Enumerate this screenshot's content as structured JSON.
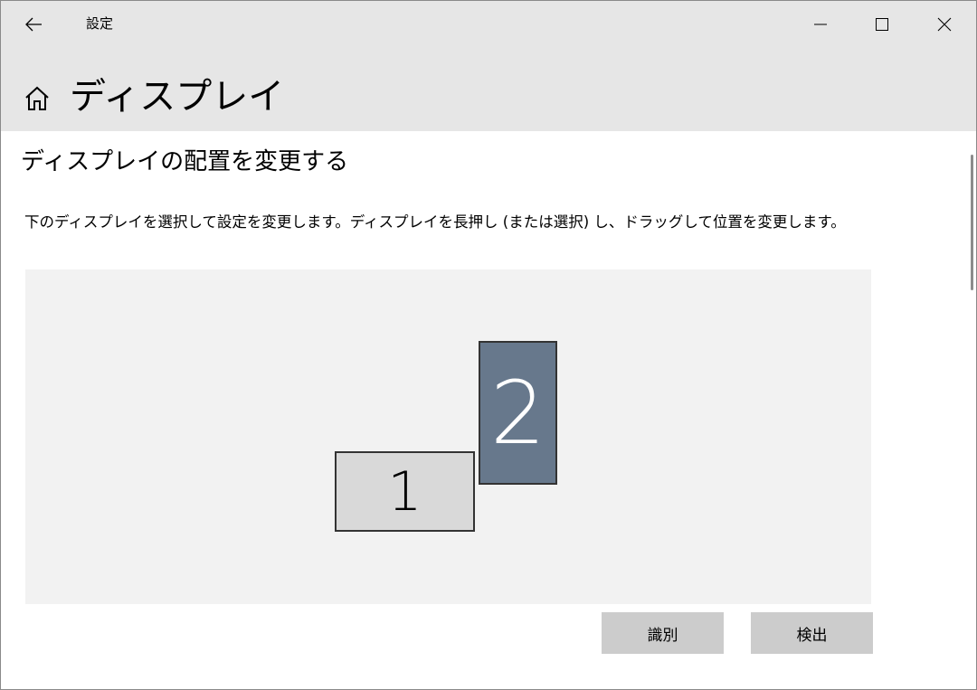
{
  "window": {
    "app_title": "設定",
    "icons": {
      "back": "back-arrow-icon",
      "minimize": "minimize-icon",
      "maximize": "maximize-icon",
      "close": "close-icon",
      "home": "home-icon"
    }
  },
  "header": {
    "title": "ディスプレイ"
  },
  "main": {
    "section_title": "ディスプレイの配置を変更する",
    "description": "下のディスプレイを選択して設定を変更します。ディスプレイを長押し (または選択) し、ドラッグして位置を変更します。",
    "displays": [
      {
        "label": "1",
        "selected": false,
        "color": "#d9d9d9"
      },
      {
        "label": "2",
        "selected": true,
        "color": "#67788c"
      }
    ],
    "buttons": {
      "identify": "識別",
      "detect": "検出"
    }
  },
  "colors": {
    "titlebar_bg": "#e6e6e6",
    "arrange_area_bg": "#f2f2f2",
    "button_bg": "#cccccc",
    "selected_display": "#67788c"
  }
}
